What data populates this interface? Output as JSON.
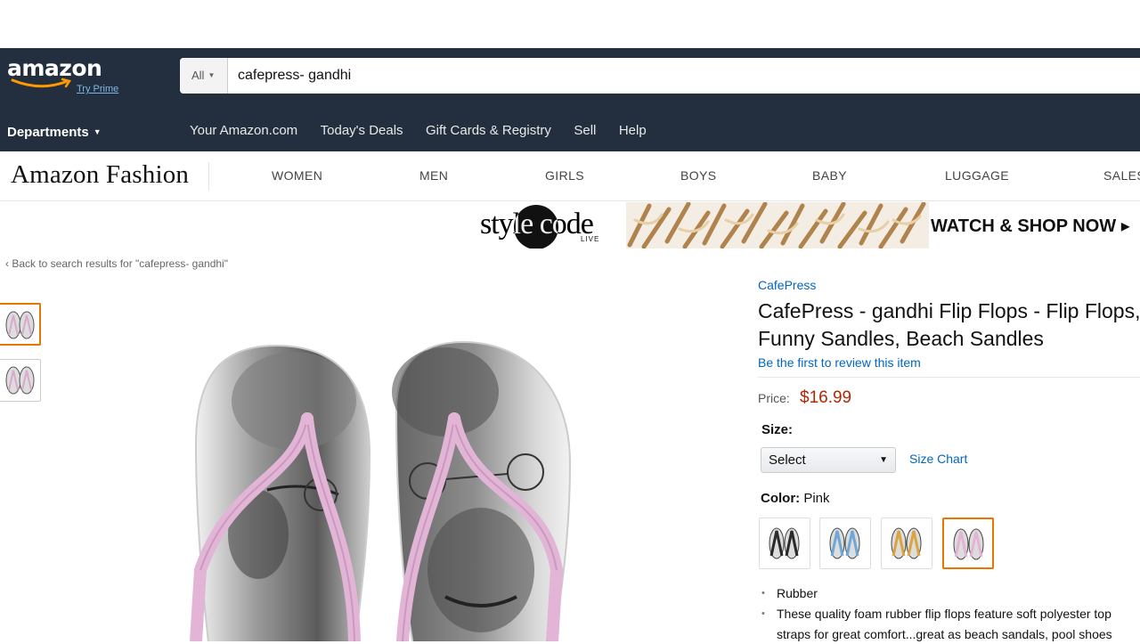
{
  "header": {
    "logo_text": "amazon",
    "try_prime": "Try Prime",
    "search_scope": "All",
    "search_value": "cafepress- gandhi",
    "departments": "Departments",
    "nav_links": [
      "Your Amazon.com",
      "Today's Deals",
      "Gift Cards & Registry",
      "Sell",
      "Help"
    ]
  },
  "fashion": {
    "logo": "Amazon Fashion",
    "categories": [
      "WOMEN",
      "MEN",
      "GIRLS",
      "BOYS",
      "BABY",
      "LUGGAGE",
      "SALES"
    ]
  },
  "banner": {
    "brand": "style code",
    "live": "LIVE",
    "cta": "WATCH & SHOP NOW ▸"
  },
  "breadcrumb": {
    "back_text": "‹ Back to search results for \"cafepress- gandhi\""
  },
  "product": {
    "brand": "CafePress",
    "title": "CafePress - gandhi Flip Flops - Flip Flops, Funny Sandles, Beach Sandles",
    "review_link": "Be the first to review this item",
    "price_label": "Price:",
    "price": "$16.99",
    "size_label": "Size:",
    "size_selected": "Select",
    "size_chart": "Size Chart",
    "color_label": "Color:",
    "color_value": "Pink",
    "swatches": [
      {
        "name": "Black",
        "strap": "#2a2a2a"
      },
      {
        "name": "Blue",
        "strap": "#6fa7d6"
      },
      {
        "name": "Gold",
        "strap": "#d9a441"
      },
      {
        "name": "Pink",
        "strap": "#e2b4d6"
      }
    ],
    "bullets": [
      "Rubber",
      "These quality foam rubber flip flops feature soft polyester top"
    ],
    "bullet_continuation": "straps for great comfort...great as beach sandals, pool shoes"
  },
  "colors": {
    "nav_bg": "#232f3e",
    "link": "#0066c0",
    "price": "#b12704",
    "selected": "#e77600",
    "strap_pink": "#e2b4d6"
  }
}
